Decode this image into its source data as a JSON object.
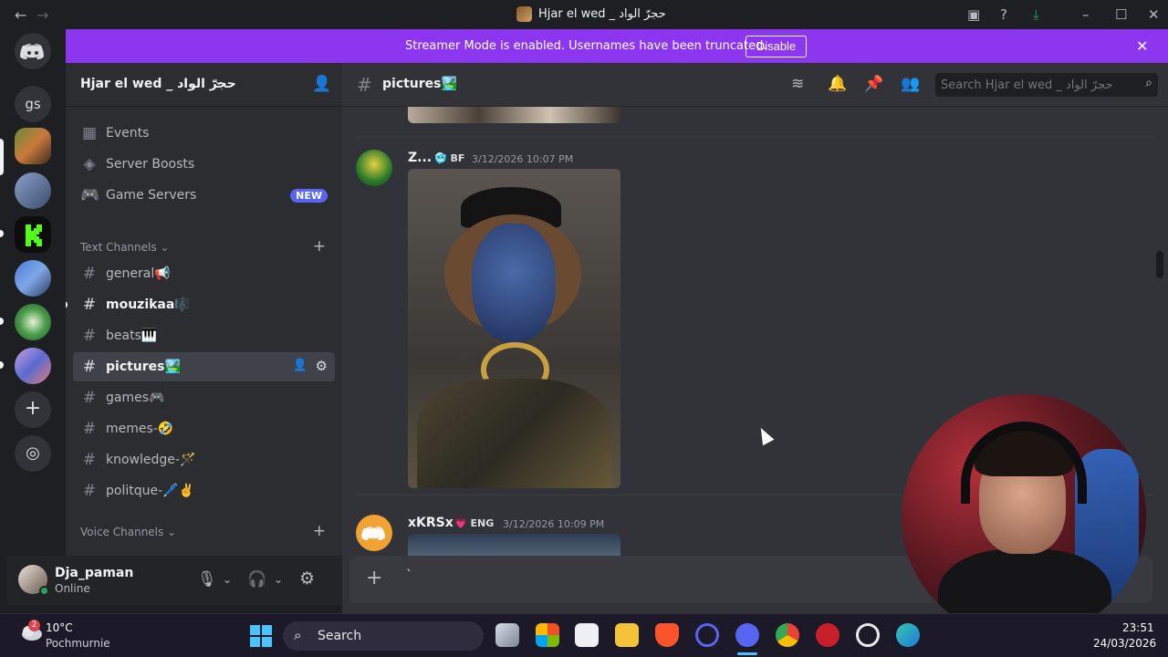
{
  "window": {
    "title": "Hjar el wed _ حجرّ الواد",
    "back_icon": "←",
    "forward_icon": "→"
  },
  "banner": {
    "text": "Streamer Mode is enabled. Usernames have been truncated.",
    "button_label": "Disable",
    "close_icon": "✕"
  },
  "rail": {
    "home_label": "",
    "gs_label": "gs",
    "add_icon": "+",
    "discover_icon": "◎"
  },
  "sidebar": {
    "server_name": "Hjar el wed _ حجرّ الواد",
    "chevron": "⌄",
    "events_label": "Events",
    "boosts_label": "Server Boosts",
    "game_servers_label": "Game Servers",
    "new_badge": "NEW",
    "text_category": "Text Channels",
    "voice_category": "Voice Channels",
    "channels": [
      {
        "name": "general📢"
      },
      {
        "name": "mouzikaa🎼"
      },
      {
        "name": "beats🎹"
      },
      {
        "name": "pictures🏞️"
      },
      {
        "name": "games🎮"
      },
      {
        "name": "memes-🤣"
      },
      {
        "name": "knowledge-🪄"
      },
      {
        "name": "politque-🖊️✌️"
      }
    ]
  },
  "user": {
    "name": "Dja_paman",
    "status": "Online"
  },
  "channel": {
    "name": "pictures🏞️",
    "search_placeholder": "Search Hjar el wed _ حجرّ الواد"
  },
  "messages": [
    {
      "author": "Z...",
      "tag": "BF",
      "tag_emoji": "🥶",
      "time": "3/12/2026 10:07 PM"
    },
    {
      "author": "xKRSx",
      "tag": "ENG",
      "tag_emoji": "💗",
      "time": "3/12/2026 10:09 PM"
    }
  ],
  "composer": {
    "plus_icon": "+",
    "input_value": "`"
  },
  "taskbar": {
    "weather_temp": "10°C",
    "weather_desc": "Pochmurnie",
    "weather_badge": "2",
    "search_label": "Search",
    "time": "23:51",
    "date": "24/03/2026"
  },
  "colors": {
    "banner": "#8c36f0",
    "online": "#23a55a",
    "new_badge": "#5865f2"
  }
}
